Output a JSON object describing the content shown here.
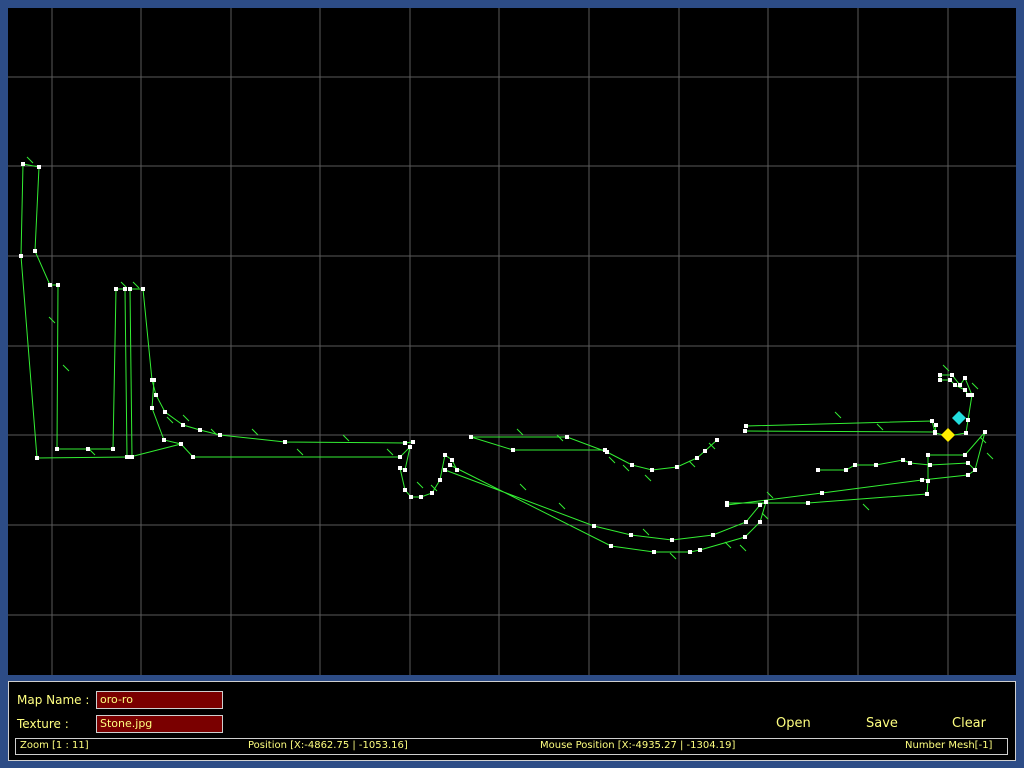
{
  "map": {
    "name_label": "Map Name :",
    "name_value": "oro-ro",
    "texture_label": "Texture :",
    "texture_value": "Stone.jpg"
  },
  "buttons": {
    "open": "Open",
    "save": "Save",
    "clear": "Clear"
  },
  "status": {
    "zoom": "Zoom [1 : 11]",
    "position": "Position [X:-4862.75 | -1053.16]",
    "mouse_position": "Mouse Position [X:-4935.27 | -1304.19]",
    "number_mesh": "Number Mesh[-1]"
  },
  "colors": {
    "background": "#2d4c86",
    "canvas": "#000000",
    "grid": "#5a5a5a",
    "mesh_line": "#33ee33",
    "vertex": "#ffffff",
    "text": "#ffff80",
    "field_bg": "#7a0000",
    "marker_cyan": "#22dddd",
    "marker_yellow": "#ffee00"
  }
}
